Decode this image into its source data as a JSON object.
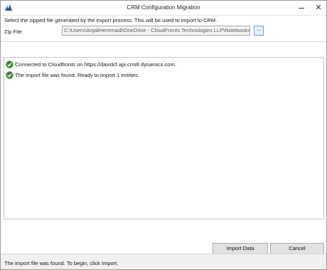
{
  "window": {
    "title": "CRM Configuration Migration",
    "icon": "crm-app-icon",
    "controls": {
      "minimize": "minimize-icon",
      "close": "✕"
    }
  },
  "main": {
    "instruction": "Select the zipped file generated by the export process. This will be used to import to CRM.",
    "zip_label": "Zip File:",
    "zip_value": "C:\\Users\\AnjaliHemmadi\\OneDrive - CloudFronts Technologies LLP\\Notebooks\\Sel",
    "browse_label": "..."
  },
  "log": {
    "items": [
      {
        "icon": "check-circle-icon",
        "text": "Connected to Cloudfronts on https://davidcf.api.crm8.dynamics.com."
      },
      {
        "icon": "check-circle-icon",
        "text": "The import file was found. Ready to import 1 entities."
      }
    ]
  },
  "buttons": {
    "import": "Import Data",
    "cancel": "Cancel"
  },
  "status": {
    "text": "The import file was found. To begin, click Import."
  },
  "colors": {
    "check_green": "#3c8a2e",
    "button_face": "#e1e1e1",
    "window_bg": "#f0f0f0"
  }
}
